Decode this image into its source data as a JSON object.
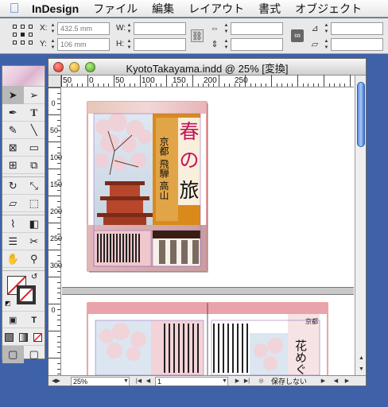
{
  "menubar": {
    "app_name": "InDesign",
    "items": [
      "ファイル",
      "編集",
      "レイアウト",
      "書式",
      "オブジェクト"
    ]
  },
  "control": {
    "x_label": "X:",
    "x_value": "432.5 mm",
    "y_label": "Y:",
    "y_value": "106 mm",
    "w_label": "W:",
    "h_label": "H:"
  },
  "document": {
    "title": "KyotoTakayama.indd @ 25% [変換]",
    "zoom": "25%",
    "page": "1",
    "save_status": "保存しない",
    "ruler_h_labels": [
      "50",
      "0",
      "50",
      "100",
      "150",
      "200",
      "250"
    ],
    "ruler_v_labels": [
      "0",
      "50",
      "100",
      "150",
      "200",
      "250",
      "300",
      "0"
    ]
  },
  "cover": {
    "headline_chars": [
      "春",
      "の",
      "旅"
    ],
    "subtitle": "京都 飛騨 高山",
    "spread_title": "花めぐ",
    "spread_sub": "京都"
  },
  "colors": {
    "accent_orange": "#d98a1a",
    "pink": "#e8a0a8",
    "desktop": "#3f61a8"
  }
}
